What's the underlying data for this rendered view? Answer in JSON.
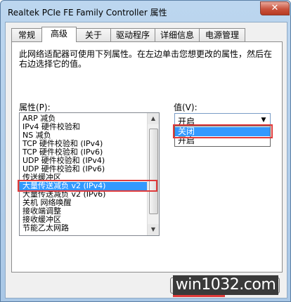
{
  "window": {
    "title": "Realtek PCIe FE Family Controller 属性",
    "close_glyph": "✕"
  },
  "tabs": [
    {
      "label": "常规",
      "active": false
    },
    {
      "label": "高级",
      "active": true
    },
    {
      "label": "关于",
      "active": false
    },
    {
      "label": "驱动程序",
      "active": false
    },
    {
      "label": "详细信息",
      "active": false
    },
    {
      "label": "电源管理",
      "active": false
    }
  ],
  "advanced": {
    "description": "此网络适配器可使用下列属性。在左边单击您想更改的属性，然后在右边选择它的值。",
    "property_label": "属性(P):",
    "value_label": "值(V):",
    "properties": [
      "ARP 减负",
      "IPv4 硬件校验和",
      "NS 减负",
      "TCP 硬件校验和 (IPv4)",
      "TCP 硬件校验和 (IPv6)",
      "UDP 硬件校验和 (IPv4)",
      "UDP 硬件校验和 (IPv6)",
      "传送缓冲区",
      "大量传送减负 v2 (IPv4)",
      "大量传送减负 v2 (IPv6)",
      "关机 网络唤醒",
      "接收端调整",
      "接收缓冲区",
      "节能乙太网路"
    ],
    "selected_property_index": 8,
    "combo_value": "开启",
    "dropdown_options": [
      "关闭",
      "开启"
    ],
    "highlighted_option_index": 0
  },
  "buttons": {},
  "watermark": {
    "text": "win1032.com"
  },
  "colors": {
    "highlight_box": "#e03a3a",
    "selection": "#3399ff"
  },
  "icons": {
    "close": "close-icon",
    "combo_arrow": "chevron-down-icon",
    "scroll_up": "arrow-up-icon",
    "scroll_down": "arrow-down-icon"
  }
}
